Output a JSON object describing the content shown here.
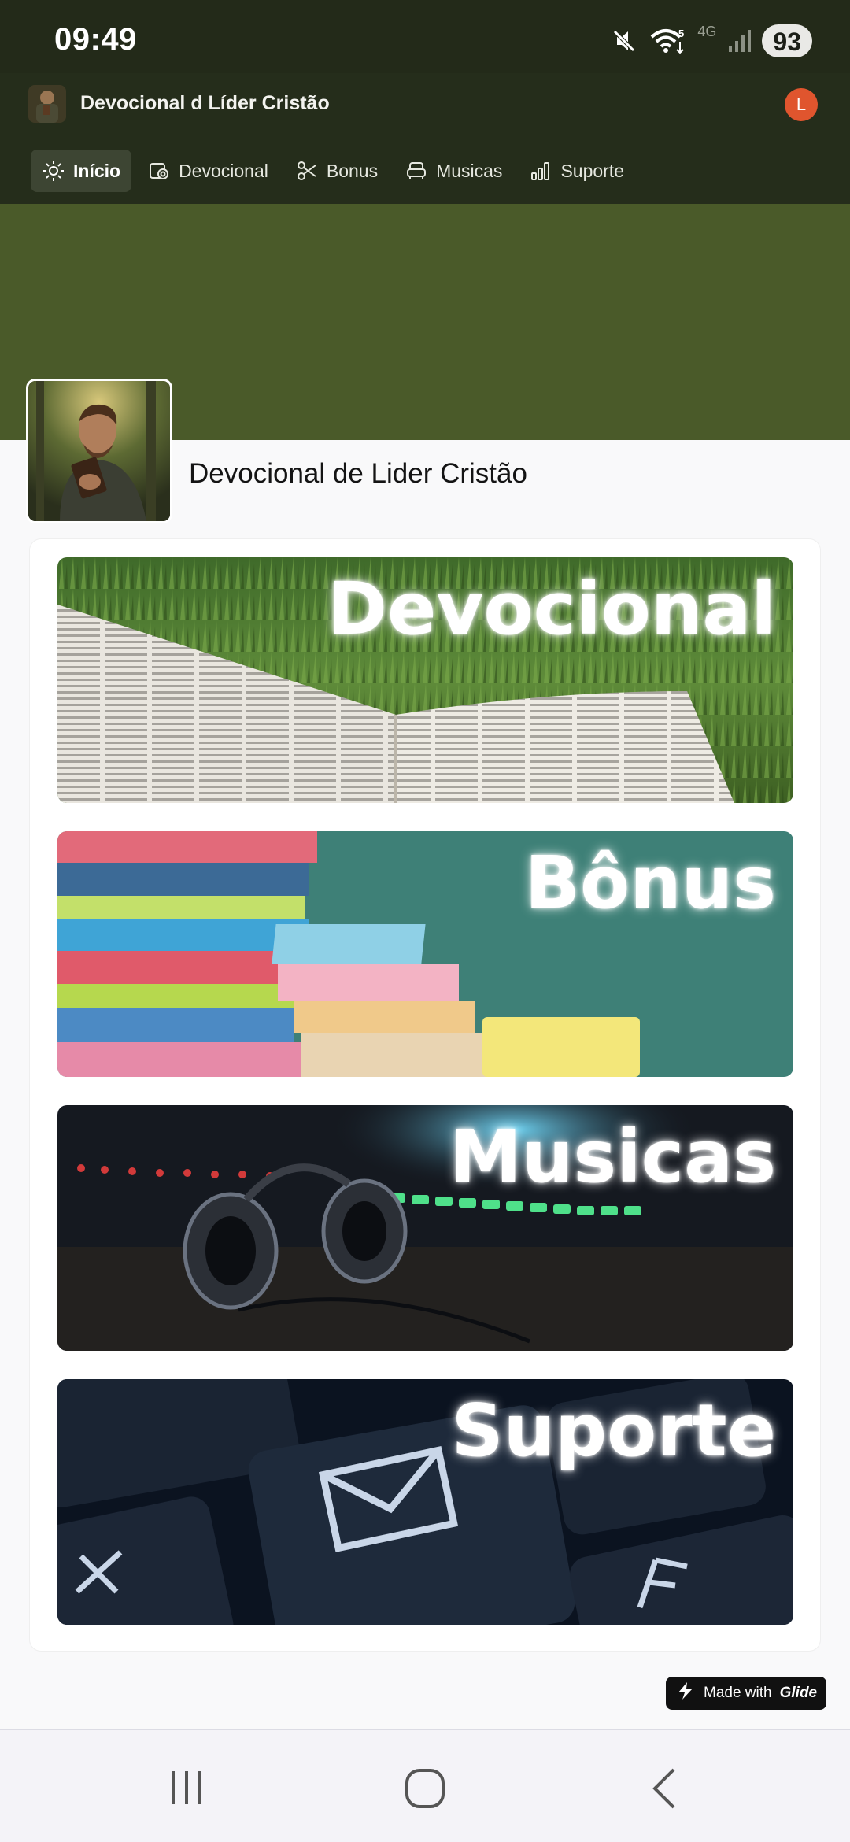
{
  "status_bar": {
    "time": "09:49",
    "network": "4G",
    "battery": "93",
    "icons": [
      "mute-icon",
      "wifi-icon",
      "signal-icon"
    ]
  },
  "header": {
    "app_title": "Devocional d Líder Cristão",
    "avatar_initial": "L",
    "nav": [
      {
        "label": "Início",
        "icon": "sun-icon",
        "active": true
      },
      {
        "label": "Devocional",
        "icon": "devocional-icon",
        "active": false
      },
      {
        "label": "Bonus",
        "icon": "scissors-icon",
        "active": false
      },
      {
        "label": "Musicas",
        "icon": "armchair-icon",
        "active": false
      },
      {
        "label": "Suporte",
        "icon": "bar-chart-icon",
        "active": false
      }
    ]
  },
  "profile": {
    "title": "Devocional de Lider Cristão"
  },
  "tiles": [
    {
      "label": "Devocional"
    },
    {
      "label": "Bônus"
    },
    {
      "label": "Musicas"
    },
    {
      "label": "Suporte"
    }
  ],
  "footer": {
    "made_with": "Made with",
    "brand": "Glide"
  },
  "colors": {
    "header_bg": "#252d1b",
    "cover_bg": "#4a5a29",
    "avatar_bg": "#e0552e",
    "page_bg": "#f9f9fa"
  }
}
